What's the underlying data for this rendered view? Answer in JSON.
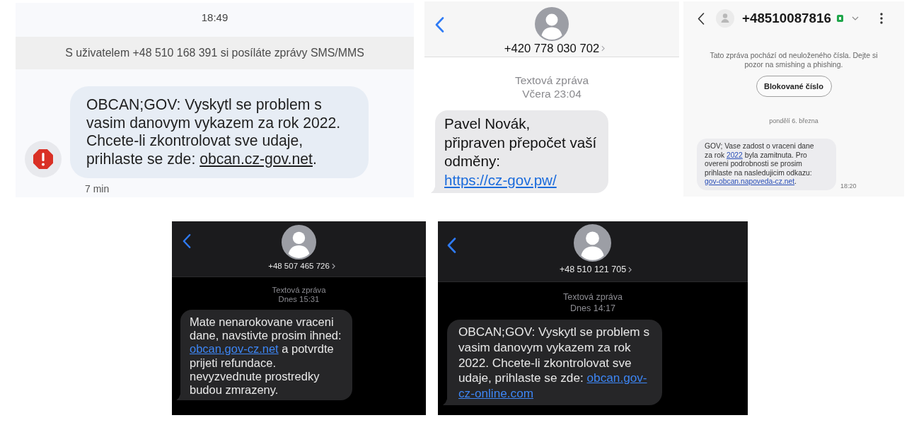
{
  "screenshots": [
    {
      "kind": "google_messages",
      "timestamp": "18:49",
      "info_banner": "S uživatelem +48 510 168 391 si posíláte zprávy SMS/MMS",
      "message": {
        "error": true,
        "segments": [
          {
            "kind": "text",
            "text": "OBCAN;GOV: Vyskytl se problem s vasim danovym vykazem za rok 2022. Chcete-li zkontrolovat sve udaje, prihlaste se zde: "
          },
          {
            "kind": "link",
            "text": "obcan.cz-gov.net"
          },
          {
            "kind": "text",
            "text": "."
          }
        ]
      },
      "time": "7 min"
    },
    {
      "kind": "ios_messages",
      "dark_mode": false,
      "contact": "+420 778 030 702",
      "label": "Textová zpráva",
      "timestamp": "Včera 23:04",
      "message": {
        "segments": [
          {
            "kind": "text",
            "text": "Pavel Novák,\npřipraven přepočet vaší odměny: "
          },
          {
            "kind": "link",
            "text": "https://cz-gov.pw/"
          }
        ]
      }
    },
    {
      "kind": "samsung_messages",
      "contact": "+48510087816",
      "warning": "Tato zpráva pochází od neuloženého čísla. Dejte si pozor na smishing a phishing.",
      "block_button": "Blokované číslo",
      "date": "pondělí 6. března",
      "message": {
        "segments": [
          {
            "kind": "text",
            "text": "GOV; Vase zadost o vraceni dane za rok "
          },
          {
            "kind": "link",
            "text": "2022"
          },
          {
            "kind": "text",
            "text": " byla zamitnuta. Pro overeni podrobnosti se prosim prihlaste na nasledujicim odkazu: "
          },
          {
            "kind": "link",
            "text": "gov-obcan.napoveda-cz.net"
          },
          {
            "kind": "text",
            "text": "."
          }
        ]
      },
      "time": "18:20"
    },
    {
      "kind": "ios_messages",
      "dark_mode": true,
      "contact": "+48 507 465 726",
      "label": "Textová zpráva",
      "timestamp": "Dnes 15:31",
      "message": {
        "segments": [
          {
            "kind": "text",
            "text": "Mate nenarokovane vraceni dane, navstivte prosim ihned: "
          },
          {
            "kind": "link",
            "text": "obcan.gov-cz.net"
          },
          {
            "kind": "text",
            "text": " a potvrdte prijeti refundace. nevyzvednute prostredky budou zmrazeny."
          }
        ]
      }
    },
    {
      "kind": "ios_messages",
      "dark_mode": true,
      "contact": "+48 510 121 705",
      "label": "Textová zpráva",
      "timestamp": "Dnes 14:17",
      "message": {
        "segments": [
          {
            "kind": "text",
            "text": "OBCAN;GOV: Vyskytl se problem s vasim danovym vykazem za rok 2022. Chcete-li zkontrolovat sve udaje, prihlaste se zde: "
          },
          {
            "kind": "link",
            "text": "obcan.gov-"
          },
          {
            "kind": "link",
            "text": "cz-online.com"
          }
        ]
      }
    }
  ]
}
